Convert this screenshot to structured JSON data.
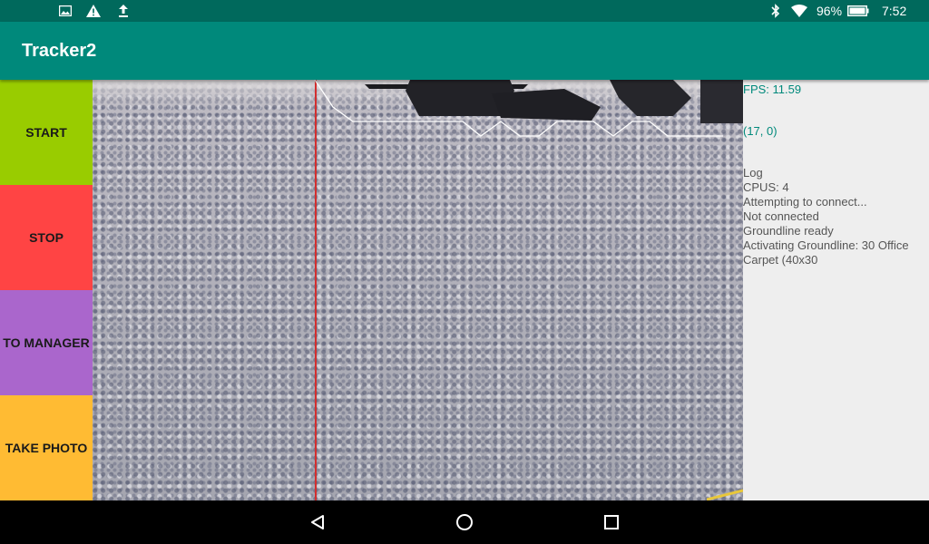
{
  "status_bar": {
    "battery_percent": "96%",
    "time": "7:52",
    "left_icons": [
      "image-icon",
      "warning-icon",
      "upload-icon"
    ],
    "right_icons": [
      "bluetooth-icon",
      "wifi-icon",
      "battery-icon"
    ]
  },
  "app_bar": {
    "title": "Tracker2"
  },
  "buttons": [
    {
      "label": "START",
      "color": "#99cc00"
    },
    {
      "label": "STOP",
      "color": "#ff4444"
    },
    {
      "label": "TO MANAGER",
      "color": "#aa66cc"
    },
    {
      "label": "TAKE PHOTO",
      "color": "#ffbb33"
    }
  ],
  "info": {
    "fps": "FPS: 11.59",
    "coords": "(17, 0)",
    "log_lines": [
      "Log",
      "CPUS: 4",
      "Attempting to connect...",
      "Not connected",
      "Groundline ready",
      "Activating Groundline: 30 Office Carpet (40x30"
    ]
  },
  "nav_bar": {
    "icons": [
      "back-icon",
      "home-icon",
      "recents-icon"
    ]
  },
  "colors": {
    "status_bar": "#00695c",
    "app_bar": "#00897b",
    "info_text": "#00897b",
    "tracking_line": "#d32f2f"
  }
}
